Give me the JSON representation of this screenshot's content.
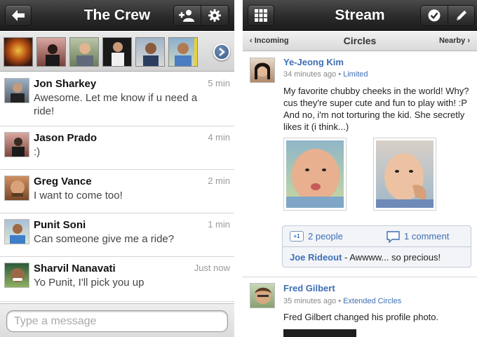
{
  "left_screen": {
    "header": {
      "title": "The Crew",
      "back_icon": "back-arrow-icon",
      "add_person_icon": "add-person-icon",
      "settings_icon": "gear-icon"
    },
    "strip_next_icon": "chevron-right-icon",
    "conversations": [
      {
        "name": "Jon Sharkey",
        "time": "5 min",
        "message": "Awesome. Let me know if u need a ride!"
      },
      {
        "name": "Jason Prado",
        "time": "4 min",
        "message": ":)"
      },
      {
        "name": "Greg Vance",
        "time": "2 min",
        "message": "I want to come too!"
      },
      {
        "name": "Punit Soni",
        "time": "1 min",
        "message": "Can someone give me a ride?"
      },
      {
        "name": "Sharvil Nanavati",
        "time": "Just now",
        "message": "Yo Punit, I'll pick you up"
      }
    ],
    "compose": {
      "placeholder": "Type a message"
    }
  },
  "right_screen": {
    "header": {
      "title": "Stream",
      "apps_icon": "grid-icon",
      "checkin_icon": "checkmark-icon",
      "compose_icon": "pencil-icon"
    },
    "circles_bar": {
      "left": "‹ Incoming",
      "center": "Circles",
      "right": "Nearby ›"
    },
    "posts": [
      {
        "author": "Ye-Jeong Kim",
        "time": "34 minutes ago",
        "circle": "Limited",
        "text": "My favorite chubby cheeks in the world! Why? cus they're super cute and fun to play with! :P And no, i'm not torturing the kid. She secretly likes it (i think...)",
        "plusone_label": "+1",
        "plusones": "2 people",
        "comments": "1 comment",
        "latest_comment_author": "Joe Rideout",
        "latest_comment_text": " - Awwww... so precious!"
      },
      {
        "author": "Fred Gilbert",
        "time": "35 minutes ago",
        "circle": "Extended Circles",
        "text": "Fred Gilbert changed his profile photo."
      }
    ]
  },
  "colors": {
    "toolbar_dark": "#2b2b2b",
    "link_blue": "#3d6fb5",
    "time_gray": "#9a9a9a"
  }
}
